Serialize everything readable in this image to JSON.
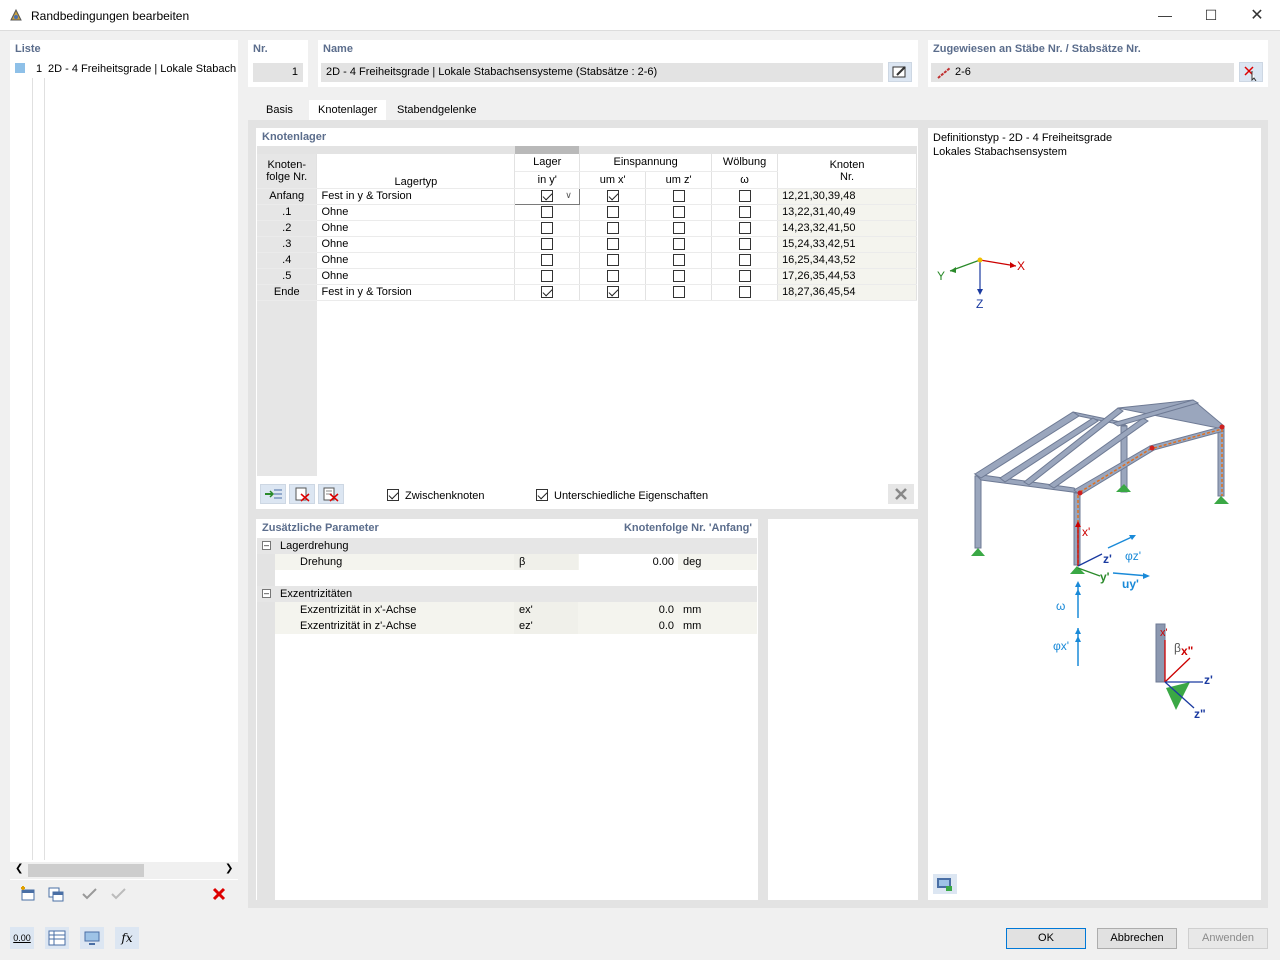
{
  "window": {
    "title": "Randbedingungen bearbeiten"
  },
  "list": {
    "header": "Liste",
    "items": [
      {
        "num": "1",
        "label": "2D - 4 Freiheitsgrade | Lokale Stabach"
      }
    ]
  },
  "nr": {
    "header": "Nr.",
    "value": "1"
  },
  "name": {
    "header": "Name",
    "value": "2D - 4 Freiheitsgrade | Lokale Stabachsensysteme (Stabsätze : 2-6)"
  },
  "assigned": {
    "header": "Zugewiesen an Stäbe Nr. / Stabsätze Nr.",
    "value": "2-6"
  },
  "tabs": [
    {
      "label": "Basis"
    },
    {
      "label": "Knotenlager"
    },
    {
      "label": "Stabendgelenke"
    }
  ],
  "knotenlager": {
    "title": "Knotenlager",
    "col_headers": {
      "knotenfolge_1": "Knoten-",
      "knotenfolge_2": "folge Nr.",
      "lagertyp": "Lagertyp",
      "lager_1": "Lager",
      "lager_2": "in y'",
      "einspannung": "Einspannung",
      "um_x": "um x'",
      "um_z": "um z'",
      "woelbung": "Wölbung",
      "omega": "ω",
      "knoten_1": "Knoten",
      "knoten_2": "Nr."
    },
    "rows": [
      {
        "folge": "Anfang",
        "typ": "Fest in y & Torsion",
        "lager_y": true,
        "um_x": true,
        "um_z": false,
        "woelbung": false,
        "knoten": "12,21,30,39,48"
      },
      {
        "folge": ".1",
        "typ": "Ohne",
        "lager_y": false,
        "um_x": false,
        "um_z": false,
        "woelbung": false,
        "knoten": "13,22,31,40,49"
      },
      {
        "folge": ".2",
        "typ": "Ohne",
        "lager_y": false,
        "um_x": false,
        "um_z": false,
        "woelbung": false,
        "knoten": "14,23,32,41,50"
      },
      {
        "folge": ".3",
        "typ": "Ohne",
        "lager_y": false,
        "um_x": false,
        "um_z": false,
        "woelbung": false,
        "knoten": "15,24,33,42,51"
      },
      {
        "folge": ".4",
        "typ": "Ohne",
        "lager_y": false,
        "um_x": false,
        "um_z": false,
        "woelbung": false,
        "knoten": "16,25,34,43,52"
      },
      {
        "folge": ".5",
        "typ": "Ohne",
        "lager_y": false,
        "um_x": false,
        "um_z": false,
        "woelbung": false,
        "knoten": "17,26,35,44,53"
      },
      {
        "folge": "Ende",
        "typ": "Fest in y & Torsion",
        "lager_y": true,
        "um_x": true,
        "um_z": false,
        "woelbung": false,
        "knoten": "18,27,36,45,54"
      }
    ],
    "zwischenknoten_label": "Zwischenknoten",
    "zwischenknoten_checked": true,
    "unterschiedliche_label": "Unterschiedliche Eigenschaften",
    "unterschiedliche_checked": true
  },
  "params": {
    "title": "Zusätzliche Parameter",
    "context": "Knotenfolge Nr. 'Anfang'",
    "groups": [
      {
        "label": "Lagerdrehung",
        "items": [
          {
            "name": "Drehung",
            "symbol": "β",
            "value": "0.00",
            "unit": "deg"
          }
        ]
      },
      {
        "label": "Exzentrizitäten",
        "items": [
          {
            "name": "Exzentrizität in x'-Achse",
            "symbol": "ex'",
            "value": "0.0",
            "unit": "mm"
          },
          {
            "name": "Exzentrizität in z'-Achse",
            "symbol": "ez'",
            "value": "0.0",
            "unit": "mm"
          }
        ]
      }
    ]
  },
  "preview": {
    "line1": "Definitionstyp - 2D - 4 Freiheitsgrade",
    "line2": "Lokales Stabachsensystem",
    "axis_labels": {
      "x": "X",
      "y": "Y",
      "z": "Z",
      "xp": "x'",
      "zp": "z'",
      "yp": "y'",
      "phi_z": "φz'",
      "u_y": "uy'",
      "omega": "ω",
      "phi_x": "φx'",
      "beta": "β",
      "xpp": "x\"",
      "zpp": "z\""
    }
  },
  "footer": {
    "ok": "OK",
    "cancel": "Abbrechen",
    "apply": "Anwenden",
    "units_icon_text": "0.00"
  },
  "colors": {
    "accent": "#0078d7",
    "header": "#5b6d8c",
    "steel": "#8c98b0",
    "support": "#3aa845"
  }
}
